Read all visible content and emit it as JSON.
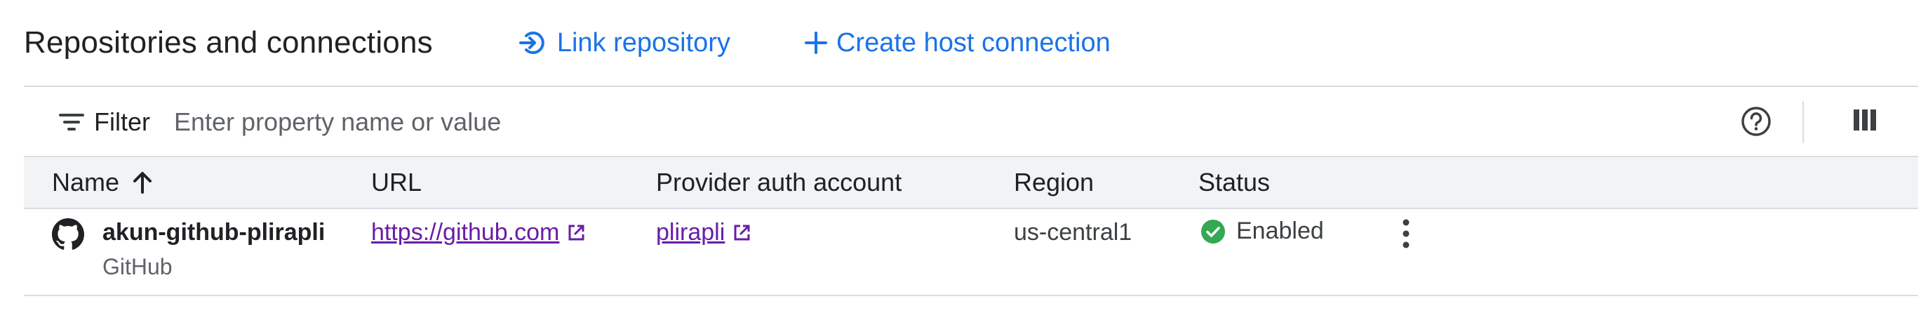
{
  "header": {
    "title": "Repositories and connections",
    "link_repository_label": "Link repository",
    "create_connection_label": "Create host connection"
  },
  "filter": {
    "label": "Filter",
    "placeholder": "Enter property name or value",
    "value": ""
  },
  "table": {
    "columns": {
      "name": "Name",
      "url": "URL",
      "provider_auth_account": "Provider auth account",
      "region": "Region",
      "status": "Status"
    },
    "sort": {
      "column": "name",
      "direction": "ascending"
    },
    "rows": [
      {
        "name": "akun-github-plirapli",
        "provider": "GitHub",
        "url": "https://github.com",
        "auth_account": "plirapli",
        "region": "us-central1",
        "status": "Enabled"
      }
    ]
  },
  "icons": {
    "link_repository": "link-in-icon",
    "create_connection": "plus-icon",
    "filter": "filter-lines-icon",
    "help": "help-circle-icon",
    "columns": "column-display-icon",
    "sort": "arrow-up-icon",
    "provider": "github-icon",
    "external": "open-in-new-icon",
    "status": "check-circle-icon",
    "more": "more-vert-icon"
  },
  "colors": {
    "accent": "#1a73e8",
    "visited_link": "#681da8",
    "success": "#34a853",
    "header_bg": "#f1f3f4",
    "divider": "#dadce0"
  }
}
